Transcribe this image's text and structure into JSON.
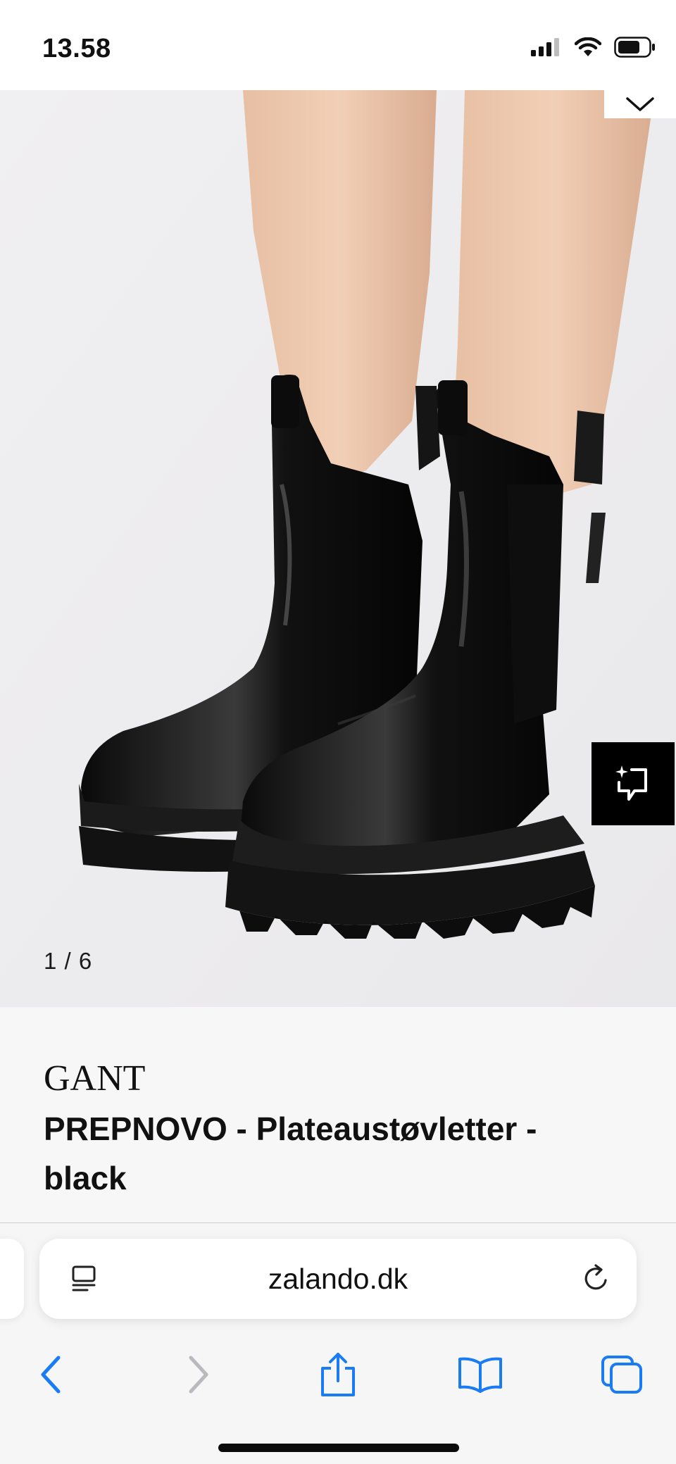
{
  "status_bar": {
    "time": "13.58",
    "icons": [
      "cellular-signal-icon",
      "wifi-icon",
      "battery-icon"
    ]
  },
  "gallery": {
    "counter": "1 / 6",
    "current_image": 1,
    "total_images": 6,
    "icons": [
      "chevron-down-icon",
      "virtual-try-on-icon"
    ]
  },
  "product": {
    "brand": "GANT",
    "name": "PREPNOVO - Plateaustøvletter - black"
  },
  "browser": {
    "url": "zalando.dk",
    "icons": [
      "reader-icon",
      "reload-icon",
      "back-icon",
      "forward-icon",
      "share-icon",
      "bookmarks-icon",
      "tabs-icon"
    ],
    "accent_color": "#1a7cf5",
    "disabled_color": "#b9b9be"
  }
}
